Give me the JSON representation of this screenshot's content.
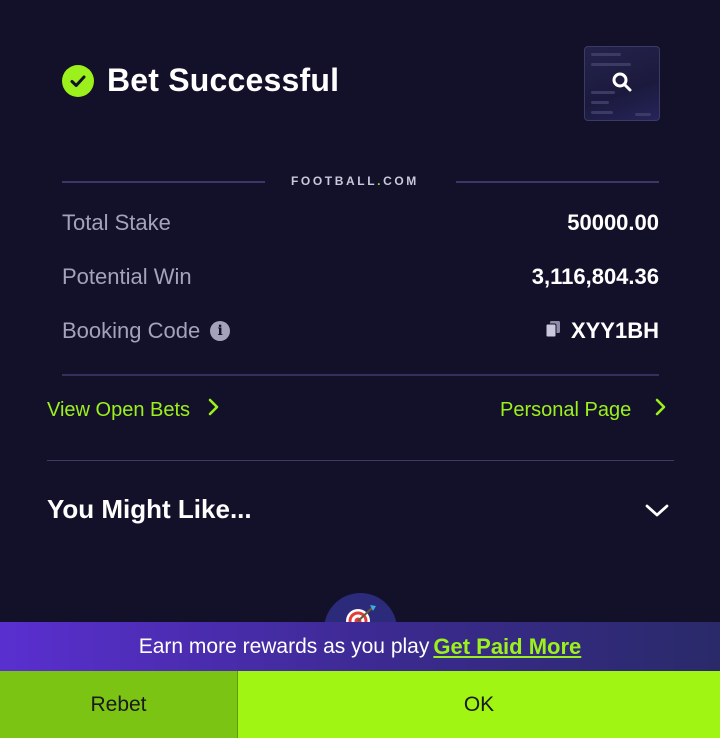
{
  "header": {
    "title": "Bet Successful"
  },
  "brand": {
    "name": "FOOTBALL",
    "dot": ".",
    "suffix": "COM"
  },
  "summary": {
    "total_stake_label": "Total Stake",
    "total_stake_value": "50000.00",
    "potential_win_label": "Potential Win",
    "potential_win_value": "3,116,804.36",
    "booking_code_label": "Booking Code",
    "booking_code_value": "XYY1BH"
  },
  "links": {
    "view_open_bets": "View Open Bets",
    "personal_page": "Personal Page"
  },
  "recommend": {
    "title": "You Might Like..."
  },
  "banner": {
    "text": "Earn more rewards as you play",
    "cta": "Get Paid More"
  },
  "actions": {
    "rebet": "Rebet",
    "ok": "OK"
  },
  "colors": {
    "background": "#13112a",
    "accent": "#9cf01b",
    "muted_text": "#a4a2bb",
    "banner_start": "#5a2fd0",
    "rebet_button": "#7cc414",
    "ok_button": "#a1f513"
  },
  "icons": [
    "check-circle-icon",
    "search-icon",
    "info-icon",
    "copy-icon",
    "chevron-right-icon",
    "chevron-down-icon",
    "target-icon"
  ]
}
